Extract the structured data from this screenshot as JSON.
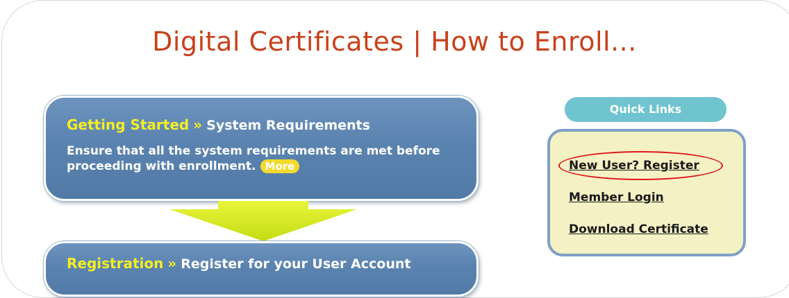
{
  "page": {
    "title": "Digital Certificates | How to Enroll..."
  },
  "steps": [
    {
      "heading": "Getting Started",
      "separator": "»",
      "subheading": "System Requirements",
      "description": "Ensure that all the system requirements are met before proceeding with enrollment.",
      "more_label": "More"
    },
    {
      "heading": "Registration",
      "separator": "»",
      "subheading": "Register for your User Account"
    }
  ],
  "quick_links": {
    "title": "Quick Links",
    "items": [
      {
        "label": "New User? Register",
        "highlighted": true
      },
      {
        "label": "Member Login"
      },
      {
        "label": "Download Certificate"
      }
    ]
  },
  "colors": {
    "title": "#c8411b",
    "step_box": "#5b83b0",
    "accent_yellow": "#f3ef25",
    "arrow": "#d6ea1e",
    "quick_links_pill": "#6fc4cf",
    "quick_links_panel": "#f4f2c5",
    "highlight_ring": "#e0161b"
  }
}
